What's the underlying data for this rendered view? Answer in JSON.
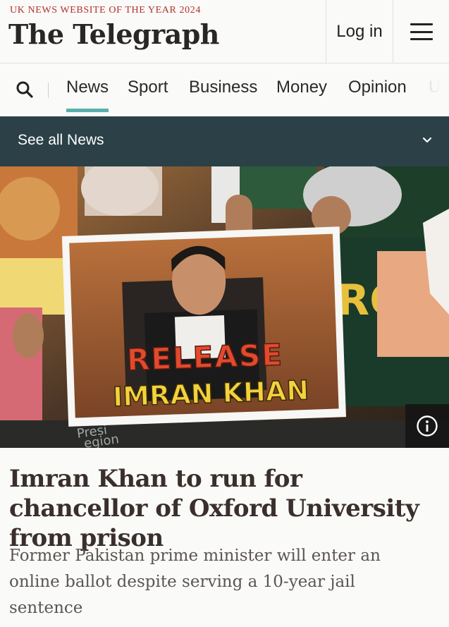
{
  "masthead": {
    "award": "UK NEWS WEBSITE OF THE YEAR 2024",
    "logo": "The Telegraph",
    "login_label": "Log in",
    "menu_icon": "hamburger-icon"
  },
  "nav": {
    "search_icon": "search-icon",
    "items": [
      {
        "label": "News",
        "active": true
      },
      {
        "label": "Sport",
        "active": false
      },
      {
        "label": "Business",
        "active": false
      },
      {
        "label": "Money",
        "active": false
      },
      {
        "label": "Opinion",
        "active": false
      },
      {
        "label": "U",
        "active": false
      }
    ],
    "active_color": "#58b0ad"
  },
  "section_bar": {
    "label": "See all News",
    "icon": "chevron-down-icon",
    "background": "#2b4147"
  },
  "hero": {
    "sign_line1": "RELEASE",
    "sign_line2": "IMRAN KHAN",
    "background_text": "Presi...egion",
    "info_icon": "info-icon"
  },
  "article": {
    "headline": "Imran Khan to run for chancellor of Oxford University from prison",
    "standfirst": "Former Pakistan prime minister will enter an online ballot despite serving a 10-year jail sentence"
  }
}
